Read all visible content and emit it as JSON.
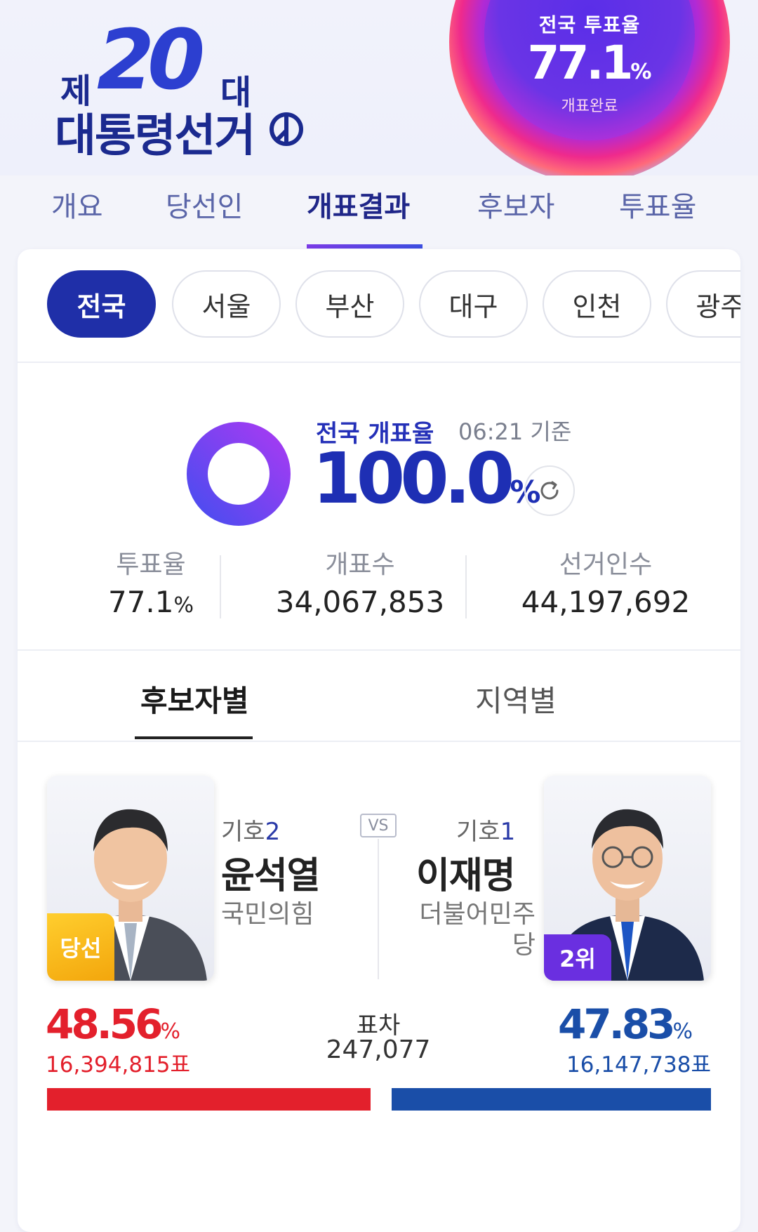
{
  "logo": {
    "ordinal_prefix": "제",
    "number": "20",
    "ordinal_suffix": "대",
    "title": "대통령선거"
  },
  "turnout_orb": {
    "label": "전국 투표율",
    "value": "77.1",
    "unit": "%",
    "status": "개표완료"
  },
  "nav": {
    "tabs": [
      "개요",
      "당선인",
      "개표결과",
      "후보자",
      "투표율"
    ],
    "active": "개표결과"
  },
  "regions": {
    "chips": [
      "전국",
      "서울",
      "부산",
      "대구",
      "인천",
      "광주"
    ],
    "active": "전국"
  },
  "count": {
    "label": "전국 개표율",
    "time": "06:21 기준",
    "value": "100.0",
    "unit": "%",
    "progress": 1.0
  },
  "stats": [
    {
      "label": "투표율",
      "value": "77.1",
      "unit": "%"
    },
    {
      "label": "개표수",
      "value": "34,067,853",
      "unit": ""
    },
    {
      "label": "선거인수",
      "value": "44,197,692",
      "unit": ""
    }
  ],
  "subtabs": {
    "items": [
      "후보자별",
      "지역별"
    ],
    "active": "후보자별"
  },
  "candidates": {
    "left": {
      "number_label": "기호",
      "number": "2",
      "name": "윤석열",
      "party": "국민의힘",
      "badge": "당선",
      "pct": "48.56",
      "unit": "%",
      "votes": "16,394,815표",
      "color": "#e3202c"
    },
    "right": {
      "number_label": "기호",
      "number": "1",
      "name": "이재명",
      "party_line1": "더불어민주",
      "party_line2": "당",
      "badge": "2위",
      "pct": "47.83",
      "unit": "%",
      "votes": "16,147,738표",
      "color": "#1a4ea8"
    },
    "vs": "VS",
    "margin_label": "표차",
    "margin_value": "247,077"
  },
  "colors": {
    "brand_navy": "#1f2fa8",
    "accent_purple": "#6a2fe0",
    "winner_red": "#e3202c",
    "runner_blue": "#1a4ea8"
  }
}
